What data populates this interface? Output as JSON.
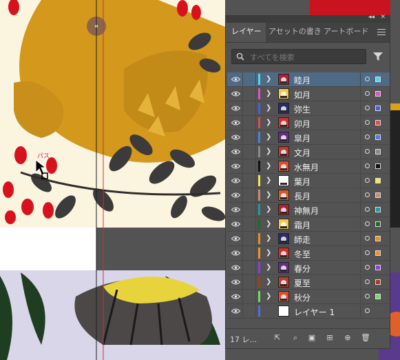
{
  "panel": {
    "tabs": [
      "レイヤー",
      "アセットの書き出",
      "アートボード"
    ],
    "search_placeholder": "すべてを検索",
    "footer_count": "17 レ..."
  },
  "canvas": {
    "path_label": "パス"
  },
  "layers": [
    {
      "name": "睦月",
      "color": "#4fd6ee",
      "selected": true
    },
    {
      "name": "如月",
      "color": "#e44fc9"
    },
    {
      "name": "弥生",
      "color": "#4d5ce0"
    },
    {
      "name": "卯月",
      "color": "#e34b4b"
    },
    {
      "name": "皐月",
      "color": "#4d7ee6"
    },
    {
      "name": "文月",
      "color": "#8a8a8a"
    },
    {
      "name": "水無月",
      "color": "#111111"
    },
    {
      "name": "葉月",
      "color": "#f2e94a"
    },
    {
      "name": "長月",
      "color": "#c98d6b"
    },
    {
      "name": "神無月",
      "color": "#1f9aa3"
    },
    {
      "name": "霜月",
      "color": "#1e6b2a"
    },
    {
      "name": "師走",
      "color": "#f08b22"
    },
    {
      "name": "冬至",
      "color": "#f09326"
    },
    {
      "name": "春分",
      "color": "#8a3fe0"
    },
    {
      "name": "夏至",
      "color": "#a83c18"
    },
    {
      "name": "秋分",
      "color": "#6be05f"
    },
    {
      "name": "レイヤー 1",
      "color": "#4d6fe0",
      "no_arrow": true,
      "blank_thumb": true
    }
  ]
}
